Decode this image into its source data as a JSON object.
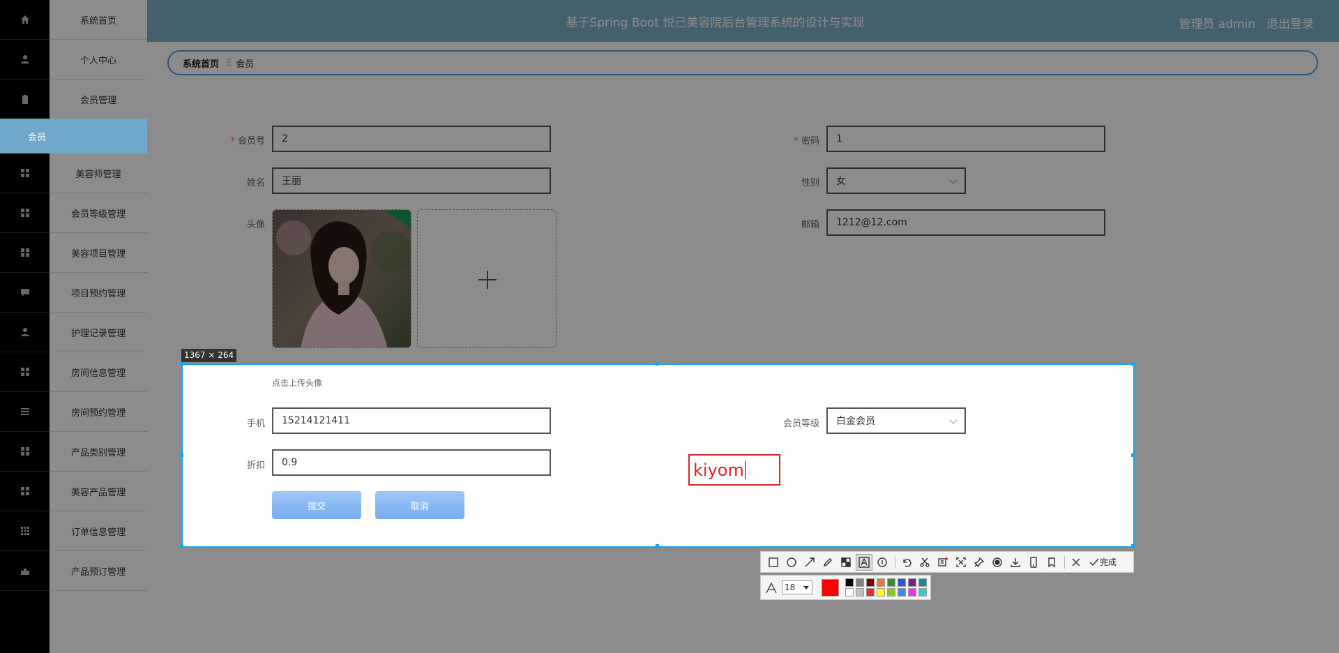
{
  "header": {
    "title": "基于Spring Boot 悦己美容院后台管理系统的设计与实现",
    "user_label": "管理员 admin",
    "logout": "退出登录"
  },
  "sidebar": {
    "items": [
      {
        "label": "系统首页",
        "icon": "home-icon"
      },
      {
        "label": "个人中心",
        "icon": "user-icon"
      },
      {
        "label": "会员管理",
        "icon": "clipboard-icon"
      },
      {
        "label": "美容师管理",
        "icon": "grid-icon"
      },
      {
        "label": "会员等级管理",
        "icon": "grid-icon"
      },
      {
        "label": "美容项目管理",
        "icon": "grid-icon"
      },
      {
        "label": "项目预约管理",
        "icon": "chat-icon"
      },
      {
        "label": "护理记录管理",
        "icon": "user-icon"
      },
      {
        "label": "房间信息管理",
        "icon": "grid-icon"
      },
      {
        "label": "房间预约管理",
        "icon": "list-icon"
      },
      {
        "label": "产品类别管理",
        "icon": "grid-icon"
      },
      {
        "label": "美容产品管理",
        "icon": "grid-icon"
      },
      {
        "label": "订单信息管理",
        "icon": "apps-icon"
      },
      {
        "label": "产品预订管理",
        "icon": "cart-icon"
      }
    ],
    "active_sub": "会员"
  },
  "breadcrumb": {
    "home": "系统首页",
    "separator": "Ξ",
    "current": "会员"
  },
  "form": {
    "member_no": {
      "label": "会员号",
      "value": "2"
    },
    "password": {
      "label": "密码",
      "value": "1"
    },
    "name": {
      "label": "姓名",
      "value": "王丽"
    },
    "gender": {
      "label": "性别",
      "value": "女"
    },
    "avatar": {
      "label": "头像",
      "hint": "点击上传头像"
    },
    "email": {
      "label": "邮箱",
      "value": "1212@12.com"
    },
    "phone": {
      "label": "手机",
      "value": "15214121411"
    },
    "level": {
      "label": "会员等级",
      "value": "白金会员"
    },
    "discount": {
      "label": "折扣",
      "value": "0.9"
    },
    "submit": "提交",
    "cancel": "取消"
  },
  "screenshot_overlay": {
    "size_label": "1367 × 264",
    "text_annotation": "kiyom",
    "done_label": "完成",
    "font_size": "18",
    "current_color": "#ff0000",
    "palette": [
      "#000000",
      "#808080",
      "#800000",
      "#e07b39",
      "#3a8a3a",
      "#3355cc",
      "#7a1e8a",
      "#1a8a8a",
      "#ffffff",
      "#c0c0c0",
      "#e03030",
      "#ffff00",
      "#88cc22",
      "#4488ee",
      "#ee33ee",
      "#33cccc"
    ]
  }
}
